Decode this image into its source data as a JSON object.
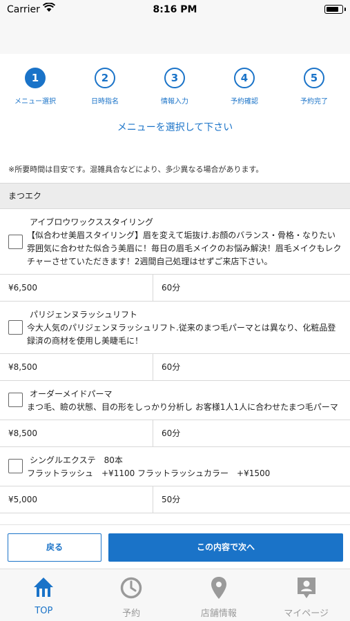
{
  "status_bar": {
    "carrier": "Carrier",
    "time": "8:16 PM"
  },
  "steps": [
    {
      "number": "1",
      "label": "メニュー選択",
      "active": true
    },
    {
      "number": "2",
      "label": "日時指名",
      "active": false
    },
    {
      "number": "3",
      "label": "情報入力",
      "active": false
    },
    {
      "number": "4",
      "label": "予約確認",
      "active": false
    },
    {
      "number": "5",
      "label": "予約完了",
      "active": false
    }
  ],
  "page_heading": "メニューを選択して下さい",
  "notice": "※所要時間は目安です。混雑具合などにより、多少異なる場合があります。",
  "category": "まつエク",
  "menu_items": [
    {
      "name": "アイブロウワックススタイリング",
      "description": "【似合わせ美眉スタイリング】眉を変えて垢抜け.お顔のバランス・骨格・なりたい雰囲気に合わせた似合う美眉に！毎日の眉毛メイクのお悩み解決！眉毛メイクもレクチャーさせていただきます！2週間自己処理はせずご来店下さい。",
      "price": "¥6,500",
      "duration": "60分"
    },
    {
      "name": "パリジェンヌラッシュリフト",
      "description": "今大人気のパリジェンヌラッシュリフト.従来のまつ毛パーマとは異なり、化粧品登録済の商材を使用し美睫毛に！",
      "price": "¥8,500",
      "duration": "60分"
    },
    {
      "name": "オーダーメイドパーマ",
      "description": "まつ毛、瞼の状態、目の形をしっかり分析し お客様1人1人に合わせたまつ毛パーマ",
      "price": "¥8,500",
      "duration": "60分"
    },
    {
      "name": "シングルエクステ　80本",
      "description": "フラットラッシュ　+¥1100 フラットラッシュカラー　+¥1500",
      "price": "¥5,000",
      "duration": "50分"
    }
  ],
  "buttons": {
    "back": "戻る",
    "next": "この内容で次へ"
  },
  "tabs": [
    {
      "label": "TOP",
      "icon": "home-icon",
      "active": true
    },
    {
      "label": "予約",
      "icon": "clock-icon",
      "active": false
    },
    {
      "label": "店舗情報",
      "icon": "map-pin-icon",
      "active": false
    },
    {
      "label": "マイページ",
      "icon": "person-badge-icon",
      "active": false
    }
  ],
  "colors": {
    "accent": "#1a73c8",
    "inactive": "#9a9a9a",
    "divider": "#d8d8d8",
    "category_bg": "#ececec"
  }
}
